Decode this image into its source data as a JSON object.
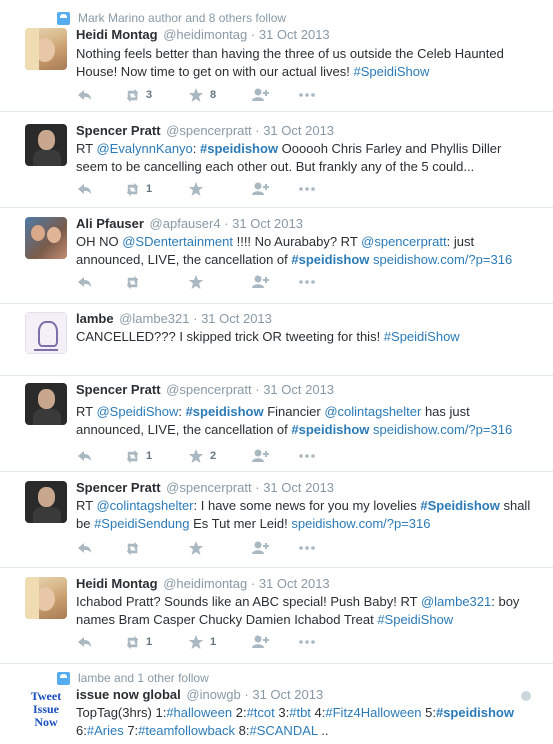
{
  "colors": {
    "link": "#2b7bb9",
    "muted": "#8899a6",
    "icon": "#aab8c2"
  },
  "tweets": [
    {
      "context": "Mark Marino author and 8 others follow",
      "name": "Heidi Montag",
      "handle": "@heidimontag",
      "date": "· 31 Oct 2013",
      "text": [
        {
          "t": "Nothing feels better than having the three of us outside the Celeb Haunted House! Now time to get on with our actual lives! ",
          "c": ""
        },
        {
          "t": "#SpeidiShow",
          "c": "lk"
        }
      ],
      "retweets": "3",
      "favorites": "8"
    },
    {
      "name": "Spencer Pratt",
      "handle": "@spencerpratt",
      "date": "· 31 Oct 2013",
      "text": [
        {
          "t": "RT ",
          "c": ""
        },
        {
          "t": "@EvalynnKanyo",
          "c": "lk"
        },
        {
          "t": ": ",
          "c": ""
        },
        {
          "t": "#speidishow",
          "c": "bl"
        },
        {
          "t": " Oooooh Chris Farley and Phyllis Diller seem to be cancelling each other out. But frankly any of the 5 could...",
          "c": ""
        }
      ],
      "retweets": "1",
      "favorites": ""
    },
    {
      "name": "Ali Pfauser",
      "handle": "@apfauser4",
      "date": "· 31 Oct 2013",
      "text": [
        {
          "t": "OH NO ",
          "c": ""
        },
        {
          "t": "@SDentertainment",
          "c": "lk"
        },
        {
          "t": " !!!! No Aurababy? RT ",
          "c": ""
        },
        {
          "t": "@spencerpratt",
          "c": "lk"
        },
        {
          "t": ": just announced, LIVE, the cancellation of ",
          "c": ""
        },
        {
          "t": "#speidishow",
          "c": "bl"
        },
        {
          "t": " ",
          "c": ""
        },
        {
          "t": "speidishow.com/?p=316",
          "c": "lk"
        }
      ],
      "retweets": "",
      "favorites": ""
    },
    {
      "name": "lambe",
      "handle": "@lambe321",
      "date": "· 31 Oct 2013",
      "text": [
        {
          "t": "CANCELLED??? I skipped trick OR tweeting for this! ",
          "c": ""
        },
        {
          "t": "#SpeidiShow",
          "c": "lk"
        }
      ],
      "retweets": "",
      "favorites": ""
    },
    {
      "name": "Spencer Pratt",
      "handle": "@spencerpratt",
      "date": "· 31 Oct 2013",
      "text": [
        {
          "t": "RT ",
          "c": ""
        },
        {
          "t": "@SpeidiShow",
          "c": "lk"
        },
        {
          "t": ": ",
          "c": ""
        },
        {
          "t": "#speidishow",
          "c": "bl"
        },
        {
          "t": " Financier ",
          "c": ""
        },
        {
          "t": "@colintagshelter",
          "c": "lk"
        },
        {
          "t": " has just announced, LIVE, the cancellation of ",
          "c": ""
        },
        {
          "t": "#speidishow",
          "c": "bl"
        },
        {
          "t": " ",
          "c": ""
        },
        {
          "t": "speidishow.com/?p=316",
          "c": "lk"
        }
      ],
      "retweets": "1",
      "favorites": "2"
    },
    {
      "name": "Spencer Pratt",
      "handle": "@spencerpratt",
      "date": "· 31 Oct 2013",
      "text": [
        {
          "t": "RT ",
          "c": ""
        },
        {
          "t": "@colintagshelter",
          "c": "lk"
        },
        {
          "t": ": I have some news for you my lovelies ",
          "c": ""
        },
        {
          "t": "#Speidishow",
          "c": "bl"
        },
        {
          "t": " shall be ",
          "c": ""
        },
        {
          "t": "#SpeidiSendung",
          "c": "lk"
        },
        {
          "t": " Es Tut mer Leid! ",
          "c": ""
        },
        {
          "t": "speidishow.com/?p=316",
          "c": "lk"
        }
      ],
      "retweets": "",
      "favorites": ""
    },
    {
      "name": "Heidi Montag",
      "handle": "@heidimontag",
      "date": "· 31 Oct 2013",
      "text": [
        {
          "t": "Ichabod Pratt? Sounds like an ABC special! Push Baby! RT ",
          "c": ""
        },
        {
          "t": "@lambe321",
          "c": "lk"
        },
        {
          "t": ": boy names Bram Casper Chucky Damien Ichabod Treat ",
          "c": ""
        },
        {
          "t": "#SpeidiShow",
          "c": "lk"
        }
      ],
      "retweets": "1",
      "favorites": "1"
    },
    {
      "context": "lambe and 1 other follow",
      "name": "issue now global",
      "handle": "@inowgb",
      "date": "· 31 Oct 2013",
      "avatar_text": [
        "Tweet",
        "Issue",
        "Now"
      ],
      "text": [
        {
          "t": "TopTag(3hrs) 1:",
          "c": ""
        },
        {
          "t": "#halloween",
          "c": "lk"
        },
        {
          "t": " 2:",
          "c": ""
        },
        {
          "t": "#tcot",
          "c": "lk"
        },
        {
          "t": " 3:",
          "c": ""
        },
        {
          "t": "#tbt",
          "c": "lk"
        },
        {
          "t": " 4:",
          "c": ""
        },
        {
          "t": "#Fitz4Halloween",
          "c": "lk"
        },
        {
          "t": " 5:",
          "c": ""
        },
        {
          "t": "#speidishow",
          "c": "bl"
        },
        {
          "t": " 6:",
          "c": ""
        },
        {
          "t": "#Aries",
          "c": "lk"
        },
        {
          "t": " 7:",
          "c": ""
        },
        {
          "t": "#teamfollowback",
          "c": "lk"
        },
        {
          "t": " 8:",
          "c": ""
        },
        {
          "t": "#SCANDAL",
          "c": "lk"
        },
        {
          "t": " ..",
          "c": ""
        }
      ],
      "retweets": "",
      "favorites": ""
    }
  ]
}
